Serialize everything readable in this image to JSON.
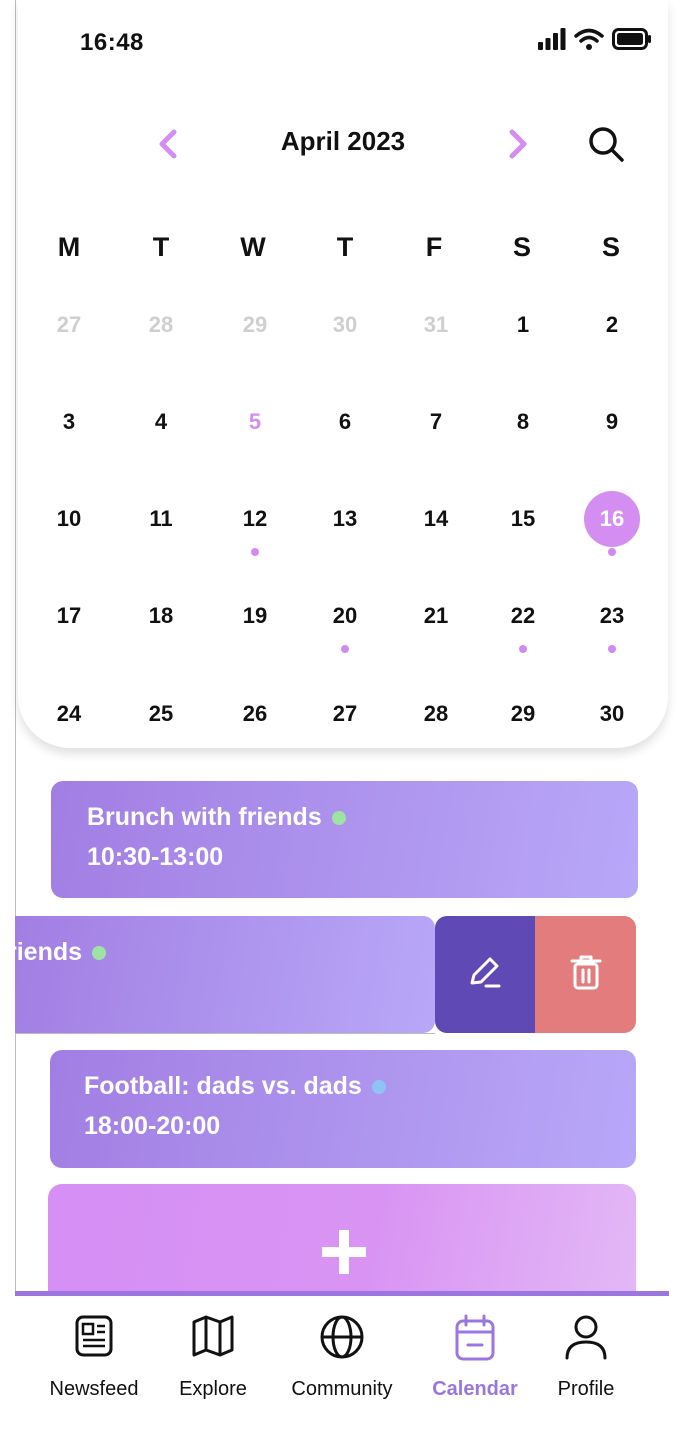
{
  "status_bar": {
    "time": "16:48"
  },
  "calendar": {
    "month_title": "April 2023",
    "weekdays": [
      "M",
      "T",
      "W",
      "T",
      "F",
      "S",
      "S"
    ],
    "weeks": [
      [
        {
          "d": "27",
          "state": "muted"
        },
        {
          "d": "28",
          "state": "muted"
        },
        {
          "d": "29",
          "state": "muted"
        },
        {
          "d": "30",
          "state": "muted"
        },
        {
          "d": "31",
          "state": "muted"
        },
        {
          "d": "1"
        },
        {
          "d": "2"
        }
      ],
      [
        {
          "d": "3"
        },
        {
          "d": "4"
        },
        {
          "d": "5",
          "state": "accent"
        },
        {
          "d": "6"
        },
        {
          "d": "7"
        },
        {
          "d": "8"
        },
        {
          "d": "9"
        }
      ],
      [
        {
          "d": "10"
        },
        {
          "d": "11"
        },
        {
          "d": "12",
          "dot": true
        },
        {
          "d": "13"
        },
        {
          "d": "14"
        },
        {
          "d": "15"
        },
        {
          "d": "16",
          "state": "selected",
          "dot": true
        }
      ],
      [
        {
          "d": "17"
        },
        {
          "d": "18"
        },
        {
          "d": "19"
        },
        {
          "d": "20",
          "dot": true
        },
        {
          "d": "21"
        },
        {
          "d": "22",
          "dot": true
        },
        {
          "d": "23",
          "dot": true
        }
      ],
      [
        {
          "d": "24"
        },
        {
          "d": "25"
        },
        {
          "d": "26"
        },
        {
          "d": "27"
        },
        {
          "d": "28"
        },
        {
          "d": "29"
        },
        {
          "d": "30"
        }
      ]
    ]
  },
  "events": [
    {
      "title": "Brunch with friends",
      "time": "10:30-13:00",
      "status_color": "#9ee3a3"
    },
    {
      "title": "riends",
      "status_color": "#9ee3a3"
    },
    {
      "title": "Football: dads vs. dads",
      "time": "18:00-20:00",
      "status_color": "#8fc3f5"
    }
  ],
  "actions": {
    "edit_icon": "pencil-icon",
    "delete_icon": "trash-icon",
    "add_icon": "plus-icon"
  },
  "tabs": [
    {
      "label": "Newsfeed",
      "icon": "newspaper-icon"
    },
    {
      "label": "Explore",
      "icon": "map-icon"
    },
    {
      "label": "Community",
      "icon": "globe-icon"
    },
    {
      "label": "Calendar",
      "icon": "calendar-icon",
      "active": true
    },
    {
      "label": "Profile",
      "icon": "person-icon"
    }
  ],
  "colors": {
    "accent": "#d48ef2",
    "tab_active": "#9b76e0",
    "edit": "#5f49b5",
    "delete": "#e37c7c"
  }
}
